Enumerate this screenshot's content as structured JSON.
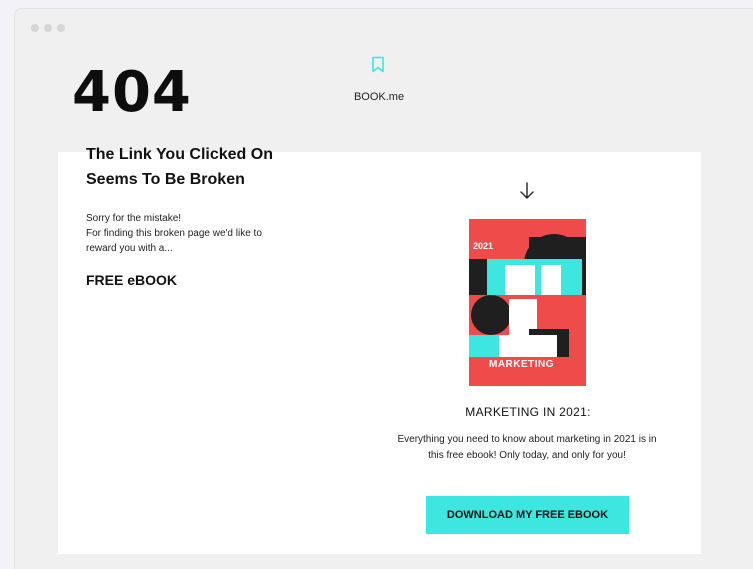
{
  "brand": {
    "name": "BOOK.me",
    "icon": "bookmark-icon",
    "accent": "#3ee6e0"
  },
  "error": {
    "code": "404",
    "headline_line1": "The Link You Clicked On",
    "headline_line2": "Seems To Be Broken",
    "message_line1": "Sorry for the mistake!",
    "message_line2": "For finding this broken page we'd like to",
    "message_line3": "reward you with a...",
    "offer": "FREE eBOOK"
  },
  "product": {
    "cover_year": "2021",
    "cover_label": "MARKETING",
    "title": "MARKETING IN 2021:",
    "desc_line1": "Everything you need to know about marketing in 2021 is in",
    "desc_line2": "this free ebook! Only today, and only for you!",
    "cta_label": "DOWNLOAD MY FREE EBOOK"
  }
}
